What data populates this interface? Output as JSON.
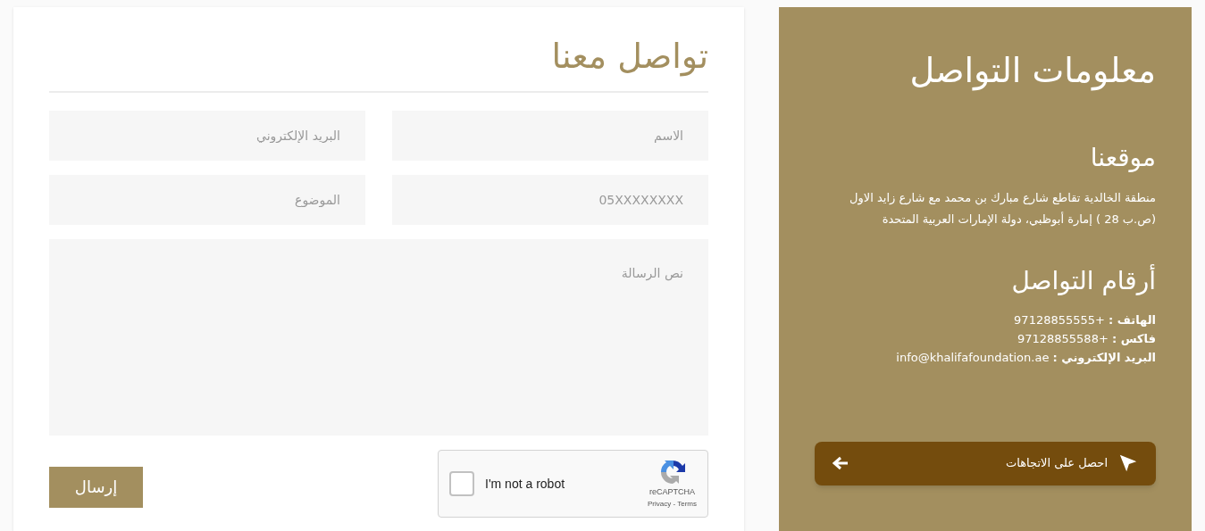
{
  "form": {
    "title": "تواصل معنا",
    "fields": [
      {
        "placeholder": "الاسم"
      },
      {
        "placeholder": "البريد الإلكتروني"
      },
      {
        "placeholder": "05XXXXXXXX"
      },
      {
        "placeholder": "الموضوع"
      }
    ],
    "message": {
      "placeholder": "نص الرسالة"
    },
    "captcha": {
      "label": "I'm not a robot",
      "checked": false,
      "brand": "reCAPTCHA",
      "links": "Privacy - Terms"
    },
    "submit": "إرسال"
  },
  "info": {
    "title": "معلومات التواصل",
    "location_title": "موقعنا",
    "address": [
      "منطقة الخالدية تقاطع شارع مبارك بن محمد مع شارع زايد الاول",
      "(ص.ب 28 ) إمارة أبوظبي، دولة الإمارات العربية المتحدة"
    ],
    "numbers_title": "أرقام التواصل",
    "contacts": [
      "**الهاتف :** +97128855555",
      "**فاكس :** +97128855588",
      "**البريد الإلكتروني :** info@khalifafoundation.ae"
    ],
    "directions": "احصل على الاتجاهات"
  }
}
